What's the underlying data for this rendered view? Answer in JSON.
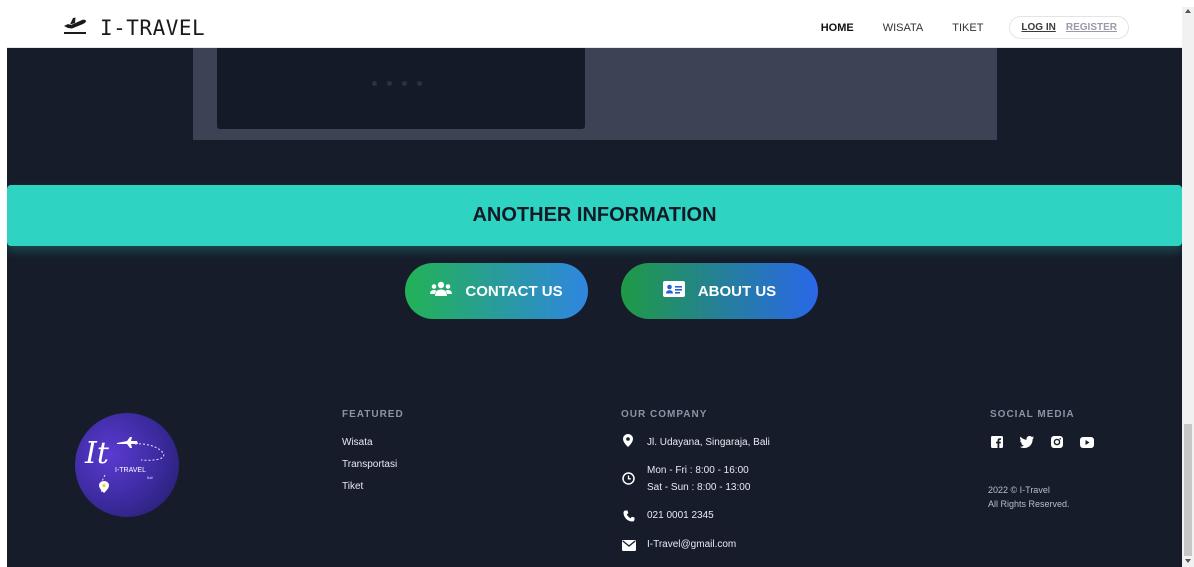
{
  "navbar": {
    "brand": "I-TRAVEL",
    "brand_icon": "plane-departure-icon",
    "links": [
      "HOME",
      "WISATA",
      "TIKET"
    ],
    "login": "LOG IN",
    "register": "REGISTER"
  },
  "banner": {
    "title": "ANOTHER INFORMATION"
  },
  "buttons": {
    "contact": "CONTACT US",
    "about": "ABOUT US"
  },
  "logo": {
    "monogram": "It",
    "text": "I-TRAVEL",
    "sub": "Bali"
  },
  "footer": {
    "featured": {
      "title": "FEATURED",
      "items": [
        "Wisata",
        "Transportasi",
        "Tiket"
      ]
    },
    "company": {
      "title": "OUR COMPANY",
      "address": "Jl. Udayana, Singaraja, Bali",
      "hours_1": "Mon - Fri : 8:00 - 16:00",
      "hours_2": "Sat - Sun : 8:00 - 13:00",
      "phone": "021 0001 2345",
      "email": "I-Travel@gmail.com"
    },
    "social": {
      "title": "SOCIAL MEDIA",
      "icons": [
        "facebook-icon",
        "twitter-icon",
        "instagram-icon",
        "youtube-icon"
      ],
      "copyright": "2022 © I-Travel",
      "rights": "All Rights Reserved."
    }
  },
  "colors": {
    "background": "#161c2a",
    "banner": "#2ed3c2",
    "contact_gradient": [
      "#22b255",
      "#2f86e0"
    ],
    "about_gradient": [
      "#1f9a45",
      "#2a67ea"
    ]
  }
}
